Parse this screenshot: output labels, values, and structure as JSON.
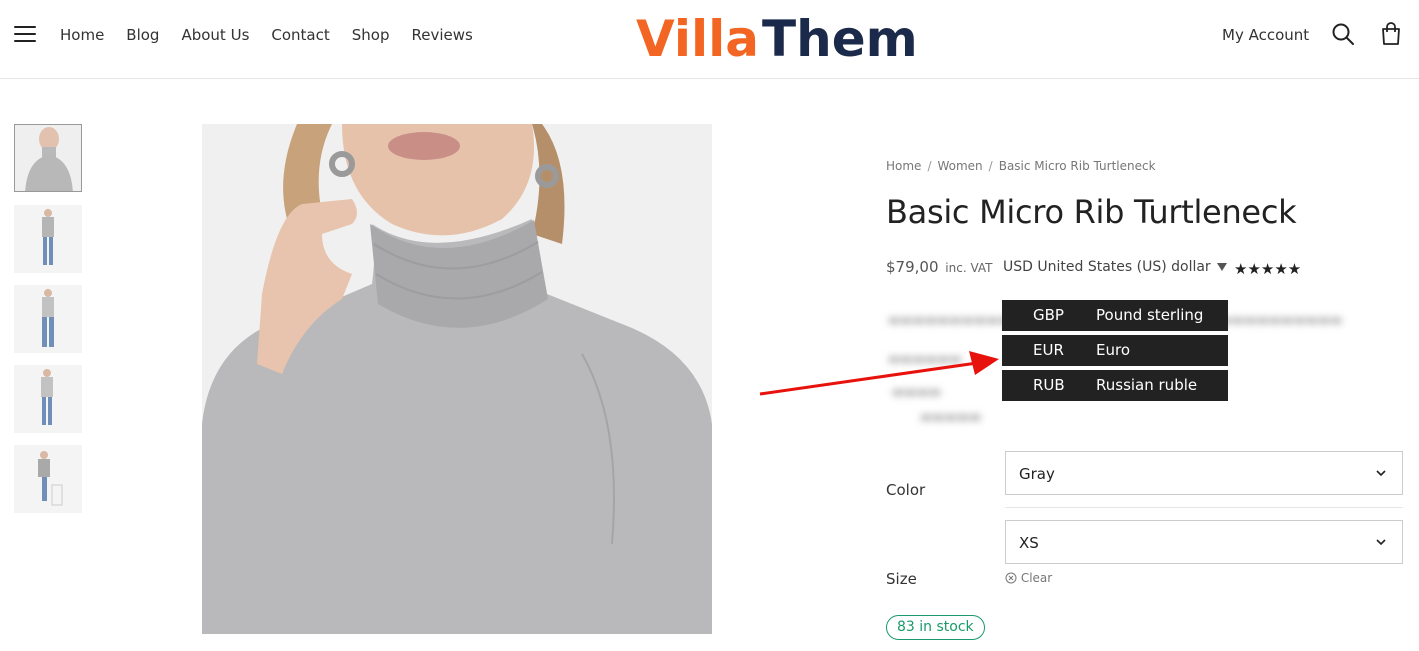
{
  "nav": {
    "items": [
      {
        "label": "Home"
      },
      {
        "label": "Blog"
      },
      {
        "label": "About Us"
      },
      {
        "label": "Contact"
      },
      {
        "label": "Shop"
      },
      {
        "label": "Reviews"
      }
    ],
    "account_label": "My Account"
  },
  "logo": {
    "text_part1": "Villa",
    "text_part2": "Theme",
    "color_part1": "#f26522",
    "color_part2": "#1b2a4a"
  },
  "breadcrumb": {
    "items": [
      "Home",
      "Women",
      "Basic Micro Rib Turtleneck"
    ]
  },
  "product": {
    "title": "Basic Micro Rib Turtleneck",
    "price": "$79,00",
    "vat_label": "inc. VAT",
    "currency_selected": "USD United States (US) dollar",
    "rating_stars": "★★★★★",
    "rating": 5
  },
  "currency_options": [
    {
      "code": "GBP",
      "name": "Pound sterling"
    },
    {
      "code": "EUR",
      "name": "Euro"
    },
    {
      "code": "RUB",
      "name": "Russian ruble"
    }
  ],
  "variations": {
    "color_label": "Color",
    "color_value": "Gray",
    "size_label": "Size",
    "size_value": "XS",
    "clear_label": "Clear"
  },
  "stock": {
    "text": "83 in stock",
    "color": "#1a9a6b"
  },
  "colors": {
    "annotation_arrow": "#e8120c",
    "dropdown_bg": "#222222"
  }
}
